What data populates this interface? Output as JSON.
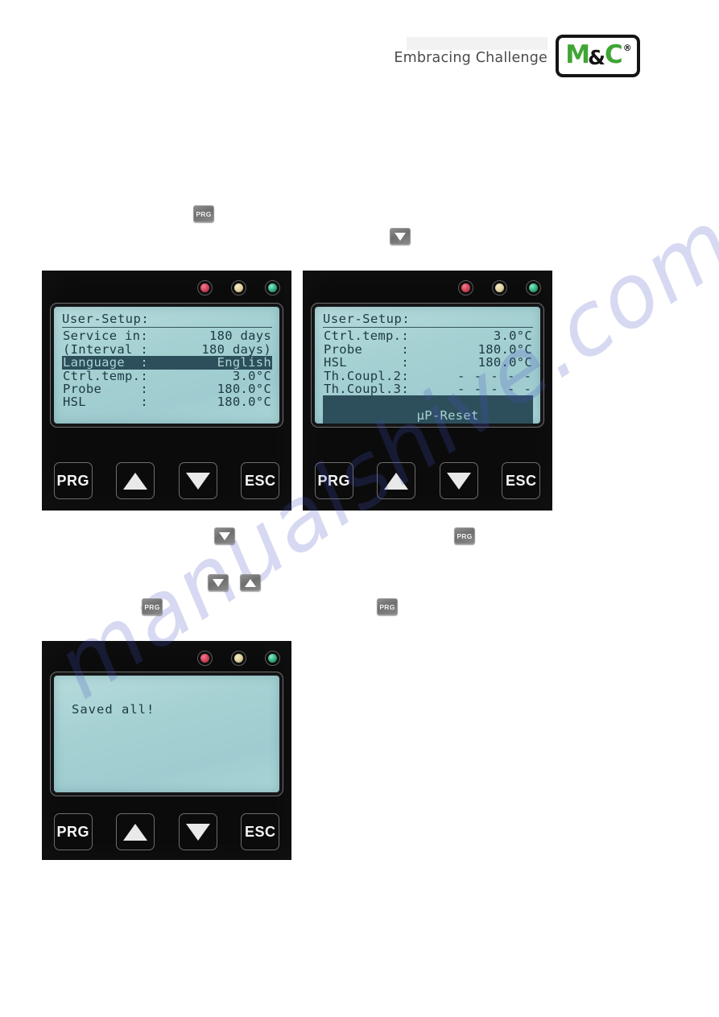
{
  "header": {
    "slogan": "Embracing Challenge",
    "logo": {
      "m": "M",
      "amp": "&",
      "c": "C",
      "registered": "®",
      "brand_color": "#3fa535",
      "frame_color": "#141414"
    }
  },
  "watermark": {
    "text": "manualshive.com",
    "color": "#4650be"
  },
  "inline_steps": [
    {
      "name": "step-prg-1",
      "icon": "prg-icon",
      "label": "PRG"
    },
    {
      "name": "step-down-1",
      "icon": "arrow-down-icon",
      "label": ""
    },
    {
      "name": "step-down-2",
      "icon": "arrow-down-icon",
      "label": ""
    },
    {
      "name": "step-prg-2",
      "icon": "prg-icon",
      "label": "PRG"
    },
    {
      "name": "step-down-3",
      "icon": "arrow-down-icon",
      "label": ""
    },
    {
      "name": "step-up-1",
      "icon": "arrow-up-icon",
      "label": ""
    },
    {
      "name": "step-prg-3",
      "icon": "prg-icon",
      "label": "PRG"
    },
    {
      "name": "step-prg-4",
      "icon": "prg-icon",
      "label": "PRG"
    }
  ],
  "keypad": {
    "prg": "PRG",
    "up": "",
    "down": "",
    "esc": "ESC"
  },
  "leds": [
    {
      "name": "led-alarm-red",
      "color": "#cf4259"
    },
    {
      "name": "led-status-amber",
      "color": "#ddcf9c"
    },
    {
      "name": "led-power-green",
      "color": "#2fae7e"
    }
  ],
  "screens": [
    {
      "id": "screen-user-setup-page1",
      "title": "User-Setup:",
      "rows": [
        {
          "label": "Service in:",
          "value": "180 days",
          "highlight": false
        },
        {
          "label": "(Interval :",
          "value": "180 days)",
          "highlight": false
        },
        {
          "label": "Language  :",
          "value": "English",
          "highlight": true
        },
        {
          "label": "Ctrl.temp.:",
          "value": "3.0°C",
          "highlight": false
        },
        {
          "label": "Probe     :",
          "value": "180.0°C",
          "highlight": false
        },
        {
          "label": "HSL       :",
          "value": "180.0°C",
          "highlight": false
        }
      ]
    },
    {
      "id": "screen-user-setup-page2",
      "title": "User-Setup:",
      "rows": [
        {
          "label": "Ctrl.temp.:",
          "value": "3.0°C",
          "highlight": false
        },
        {
          "label": "Probe     :",
          "value": "180.0°C",
          "highlight": false
        },
        {
          "label": "HSL       :",
          "value": "180.0°C",
          "highlight": false
        },
        {
          "label": "Th.Coupl.2:",
          "value": "- - - - -",
          "highlight": false
        },
        {
          "label": "Th.Coupl.3:",
          "value": "- - - - -",
          "highlight": false
        },
        {
          "label": "µP-Reset        :",
          "value": "",
          "highlight": true
        }
      ]
    },
    {
      "id": "screen-saved-all",
      "title": "",
      "message": "Saved all!",
      "rows": []
    }
  ]
}
